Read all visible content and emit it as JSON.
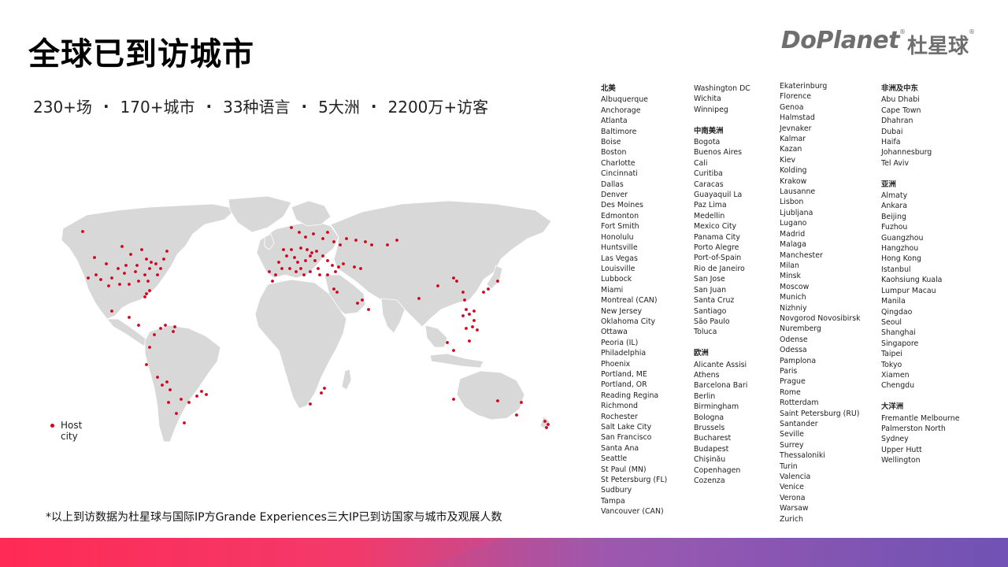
{
  "title": "全球已到访城市",
  "logo": {
    "en": "DoPlanet",
    "cn": "杜星球",
    "reg": "®"
  },
  "stats": [
    "230+场",
    "170+城市",
    "33种语言",
    "5大洲",
    "2200万+访客"
  ],
  "stat_separator": "·",
  "legend": {
    "label": "Host city",
    "dot_color": "#d0021b"
  },
  "footnote": "*以上到访数据为杜星球与国际IP方Grande Experiences三大IP已到访国家与城市及观展人数",
  "colors": {
    "land": "#d8d8d8",
    "marker": "#d0021b"
  },
  "columns": [
    {
      "sections": [
        {
          "heading": "北美",
          "items": [
            "Albuquerque",
            "Anchorage",
            "Atlanta",
            "Baltimore",
            "Boise",
            "Boston",
            "Charlotte",
            "Cincinnati",
            "Dallas",
            "Denver",
            "Des Moines",
            "Edmonton",
            "Fort Smith",
            "Honolulu",
            "Huntsville",
            "Las Vegas",
            "Louisville",
            "Lubbock",
            "Miami",
            "Montreal (CAN)",
            "New Jersey",
            "Oklahoma City",
            "Ottawa",
            "Peoria (IL)",
            "Philadelphia",
            "Phoenix",
            "Portland, ME",
            "Portland, OR",
            "Reading Regina",
            "Richmond",
            "Rochester",
            "Salt Lake City",
            "San Francisco",
            "Santa Ana",
            "Seattle",
            "St Paul (MN)",
            "St Petersburg (FL)",
            "Sudbury",
            "Tampa",
            "Vancouver (CAN)"
          ]
        }
      ]
    },
    {
      "sections": [
        {
          "heading": "",
          "items": [
            "Washington DC",
            "Wichita",
            "Winnipeg"
          ]
        },
        {
          "heading": "中南美洲",
          "items": [
            "Bogota",
            "Buenos Aires",
            "Cali",
            "Curitiba",
            "Caracas",
            "Guayaquil La",
            "Paz Lima",
            "Medellin",
            "Mexico City",
            "Panama City",
            "Porto Alegre",
            "Port-of-Spain",
            "Rio de Janeiro",
            "San Jose",
            "San Juan",
            "Santa Cruz",
            "Santiago",
            "São Paulo",
            "Toluca"
          ]
        },
        {
          "heading": "欧洲",
          "items": [
            "Alicante Assisi",
            "Athens",
            "Barcelona Bari",
            "Berlin",
            "Birmingham",
            "Bologna",
            "Brussels",
            "Bucharest",
            "Budapest",
            "Chișinău",
            "Copenhagen",
            "Cozenza"
          ]
        }
      ]
    },
    {
      "sections": [
        {
          "heading": "",
          "items": [
            "Ekaterinburg",
            "Florence",
            "Genoa",
            "Halmstad",
            "Jevnaker",
            "Kalmar",
            "Kazan",
            "Kiev",
            "Kolding",
            "Krakow",
            "Lausanne",
            "Lisbon",
            "Ljubljana",
            "Lugano",
            "Madrid",
            "Malaga",
            "Manchester",
            "Milan",
            "Minsk",
            "Moscow",
            "Munich",
            "Nizhniy",
            "Novgorod Novosibirsk",
            "Nuremberg",
            "Odense",
            "Odessa",
            "Pamplona",
            "Paris",
            "Prague",
            "Rome",
            "Rotterdam",
            "Saint Petersburg (RU)",
            "Santander",
            "Seville",
            "Surrey",
            "Thessaloniki",
            "Turin",
            "Valencia",
            "Venice",
            "Verona",
            "Warsaw",
            "Zurich"
          ]
        }
      ]
    },
    {
      "sections": [
        {
          "heading": "非洲及中东",
          "items": [
            "Abu Dhabi",
            "Cape Town",
            "Dhahran",
            "Dubai",
            "Haifa",
            "Johannesburg",
            "Tel Aviv"
          ]
        },
        {
          "heading": "亚洲",
          "items": [
            "Almaty",
            "Ankara",
            "Beijing",
            "Fuzhou",
            "Guangzhou",
            "Hangzhou",
            "Hong Kong",
            "Istanbul",
            "Kaohsiung Kuala",
            "Lumpur Macau",
            "Manila",
            "Qingdao",
            "Seoul",
            "Shanghai",
            "Singapore",
            "Taipei",
            "Tokyo",
            "Xiamen",
            "Chengdu"
          ]
        },
        {
          "heading": "大洋洲",
          "items": [
            "Fremantle Melbourne",
            "Palmerston North",
            "Sydney",
            "Upper Hutt",
            "Wellington"
          ]
        }
      ]
    }
  ]
}
